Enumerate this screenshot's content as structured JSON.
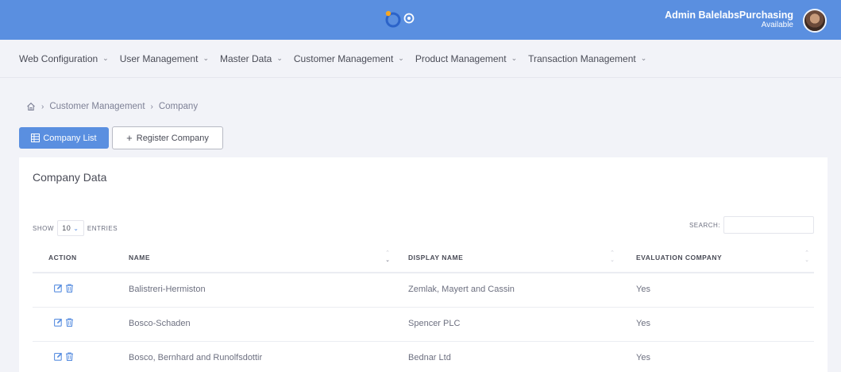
{
  "header": {
    "user_name": "Admin BalelabsPurchasing",
    "user_status": "Available"
  },
  "menu": [
    {
      "label": "Web Configuration"
    },
    {
      "label": "User Management"
    },
    {
      "label": "Master Data"
    },
    {
      "label": "Customer Management"
    },
    {
      "label": "Product Management"
    },
    {
      "label": "Transaction Management"
    }
  ],
  "breadcrumb": {
    "section": "Customer Management",
    "page": "Company"
  },
  "tabs": {
    "list_label": "Company List",
    "register_label": "Register Company"
  },
  "card": {
    "title": "Company Data",
    "show_label": "SHOW",
    "entries_value": "10",
    "entries_label": "ENTRIES",
    "search_label": "SEARCH:",
    "search_value": ""
  },
  "table": {
    "columns": [
      "ACTION",
      "NAME",
      "DISPLAY NAME",
      "EVALUATION COMPANY"
    ],
    "rows": [
      {
        "name": "Balistreri-Hermiston",
        "display_name": "Zemlak, Mayert and Cassin",
        "evaluation": "Yes"
      },
      {
        "name": "Bosco-Schaden",
        "display_name": "Spencer PLC",
        "evaluation": "Yes"
      },
      {
        "name": "Bosco, Bernhard and Runolfsdottir",
        "display_name": "Bednar Ltd",
        "evaluation": "Yes"
      }
    ]
  },
  "colors": {
    "primary": "#5a8fe0",
    "background": "#f2f3f8",
    "card": "#ffffff",
    "action_icon": "#5a8fe0"
  },
  "icons": {
    "logo": "logo-icon",
    "home": "home-icon",
    "menu_chevron": "chevron-down-icon",
    "list": "grid-icon",
    "register": "plus-icon",
    "edit": "edit-icon",
    "delete": "trash-icon",
    "sort": "sort-icon"
  }
}
